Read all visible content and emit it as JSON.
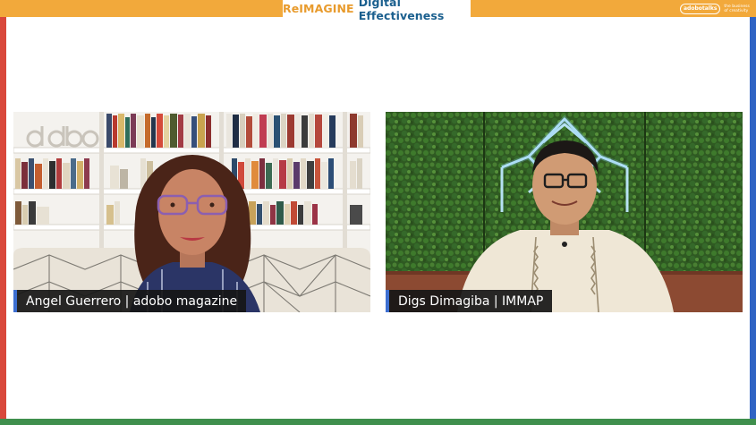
{
  "header": {
    "title_accent": "ReIMAGINE",
    "title_rest": "Digital Effectiveness",
    "brand_logo": "adobotalks",
    "brand_tagline": "the business of creativity"
  },
  "participants": [
    {
      "name_label": "Angel Guerrero | adobo magazine"
    },
    {
      "name_label": "Digs Dimagiba | IMMAP"
    }
  ],
  "colors": {
    "top_bar": "#f2a93b",
    "left_edge": "#d9483b",
    "right_edge": "#2f63c4",
    "bottom_edge": "#3f8f4d",
    "name_tag_accent": "#3d6fd1"
  }
}
